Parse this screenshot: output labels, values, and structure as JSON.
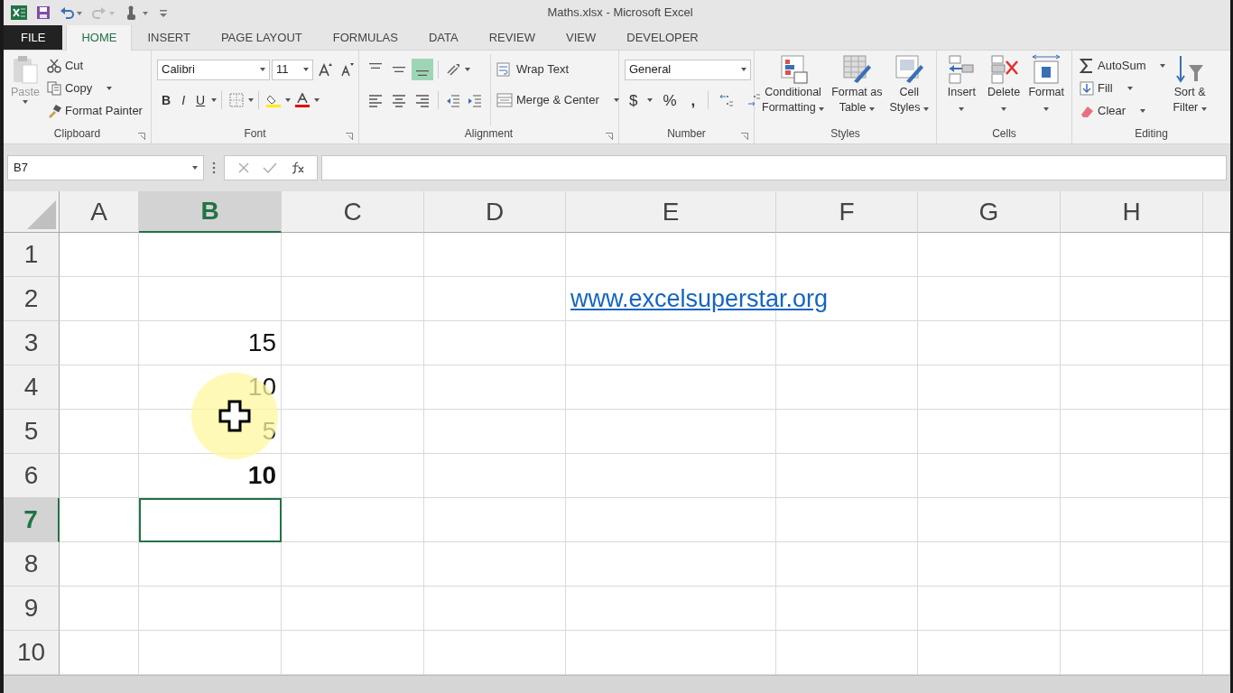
{
  "window": {
    "title": "Maths.xlsx - Microsoft Excel"
  },
  "tabs": [
    {
      "label": "FILE",
      "kind": "file",
      "selected": false
    },
    {
      "label": "HOME",
      "kind": "tab",
      "selected": true
    },
    {
      "label": "INSERT",
      "kind": "tab",
      "selected": false
    },
    {
      "label": "PAGE LAYOUT",
      "kind": "tab",
      "selected": false
    },
    {
      "label": "FORMULAS",
      "kind": "tab",
      "selected": false
    },
    {
      "label": "DATA",
      "kind": "tab",
      "selected": false
    },
    {
      "label": "REVIEW",
      "kind": "tab",
      "selected": false
    },
    {
      "label": "VIEW",
      "kind": "tab",
      "selected": false
    },
    {
      "label": "DEVELOPER",
      "kind": "tab",
      "selected": false
    }
  ],
  "ribbon": {
    "groups": [
      {
        "label": "Clipboard",
        "controls": [
          {
            "label": "Paste",
            "disabled": true
          },
          {
            "label": "Cut"
          },
          {
            "label": "Copy",
            "dropdown": true
          },
          {
            "label": "Format Painter"
          }
        ]
      },
      {
        "label": "Font",
        "controls": [
          {
            "value": "Calibri"
          },
          {
            "value": "11"
          },
          {
            "label": "B"
          },
          {
            "label": "I"
          },
          {
            "label": "U"
          }
        ]
      },
      {
        "label": "Alignment",
        "align_buttons": [
          {
            "selected": false
          },
          {
            "selected": false
          },
          {
            "selected": true
          },
          {
            "selected": false
          },
          {
            "selected": false
          },
          {
            "selected": false
          }
        ],
        "controls": [
          {
            "label": "Wrap Text"
          },
          {
            "label": "Merge & Center",
            "dropdown": true
          }
        ]
      },
      {
        "label": "Number",
        "controls": [
          {
            "value": "General"
          },
          {
            "label": "$",
            "dropdown": true
          },
          {
            "label": "%"
          },
          {
            "label": ","
          }
        ]
      },
      {
        "label": "Styles",
        "controls": [
          {
            "lines": [
              "Conditional",
              "Formatting"
            ]
          },
          {
            "lines": [
              "Format as",
              "Table"
            ]
          },
          {
            "lines": [
              "Cell",
              "Styles"
            ]
          }
        ]
      },
      {
        "label": "Cells",
        "controls": [
          {
            "lines": [
              "Insert"
            ]
          },
          {
            "lines": [
              "Delete"
            ]
          },
          {
            "lines": [
              "Format"
            ]
          }
        ]
      },
      {
        "label": "Editing",
        "controls": [
          {
            "label": "AutoSum",
            "dropdown": true
          },
          {
            "label": "Fill",
            "dropdown": true
          },
          {
            "label": "Clear",
            "dropdown": true
          },
          {
            "lines": [
              "Sort &",
              "Filter"
            ]
          }
        ]
      }
    ]
  },
  "formula_bar": {
    "name_box": "B7"
  },
  "sheet": {
    "columns": [
      {
        "label": "A",
        "selected": false
      },
      {
        "label": "B",
        "selected": true
      },
      {
        "label": "C",
        "selected": false
      },
      {
        "label": "D",
        "selected": false
      },
      {
        "label": "E",
        "selected": false
      },
      {
        "label": "F",
        "selected": false
      },
      {
        "label": "G",
        "selected": false
      },
      {
        "label": "H",
        "selected": false
      }
    ],
    "rows": [
      {
        "label": "1",
        "selected": false,
        "cells": []
      },
      {
        "label": "2",
        "selected": false,
        "cells": [
          null,
          null,
          null,
          null,
          {
            "value": "www.excelsuperstar.org",
            "kind": "link"
          }
        ]
      },
      {
        "label": "3",
        "selected": false,
        "cells": [
          null,
          {
            "value": "15",
            "kind": "number",
            "bold": false
          }
        ]
      },
      {
        "label": "4",
        "selected": false,
        "cells": [
          null,
          {
            "value": "10",
            "kind": "number",
            "bold": false
          }
        ]
      },
      {
        "label": "5",
        "selected": false,
        "cells": [
          null,
          {
            "value": "5",
            "kind": "number",
            "bold": false
          }
        ]
      },
      {
        "label": "6",
        "selected": false,
        "cells": [
          null,
          {
            "value": "10",
            "kind": "number",
            "bold": true
          }
        ]
      },
      {
        "label": "7",
        "selected": true,
        "cells": [
          null,
          {
            "active": true
          }
        ]
      },
      {
        "label": "8",
        "selected": false,
        "cells": []
      },
      {
        "label": "9",
        "selected": false,
        "cells": []
      },
      {
        "label": "10",
        "selected": false,
        "cells": []
      }
    ]
  }
}
